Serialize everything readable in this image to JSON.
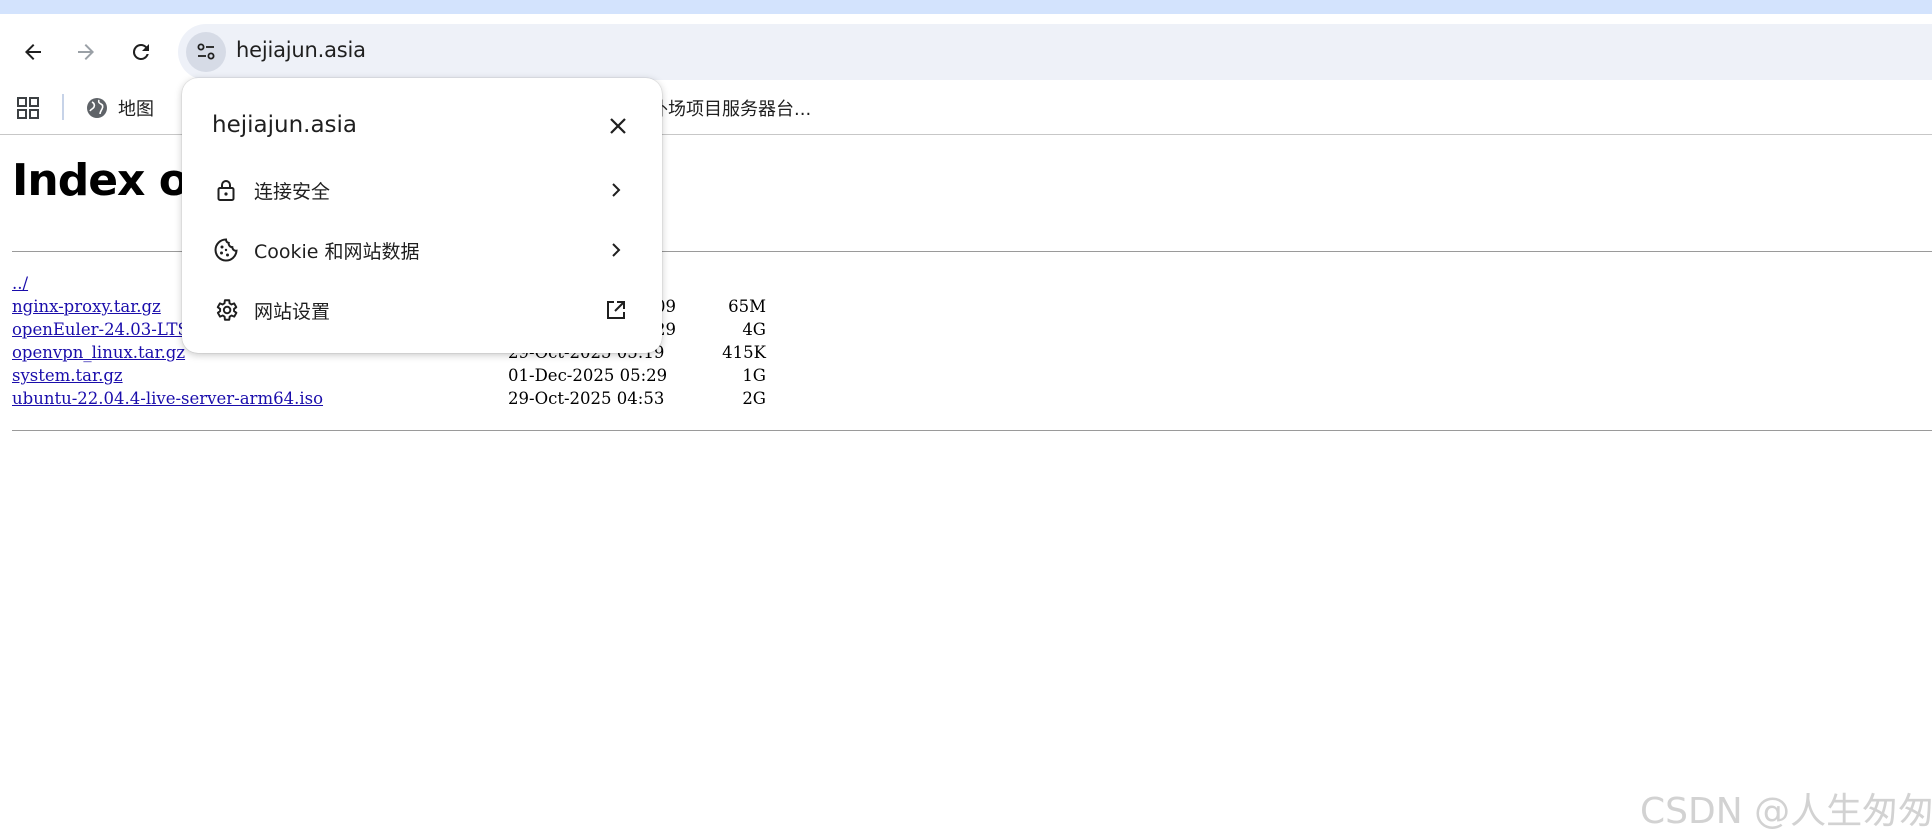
{
  "browser": {
    "url": "hejiajun.asia",
    "bookmarks": [
      {
        "label": "地图",
        "icon": "globe-icon"
      },
      {
        "label": "外场项目服务器台...",
        "icon": ""
      }
    ]
  },
  "page": {
    "heading": "Index of /",
    "parent_link": "../",
    "files": [
      {
        "name": "nginx-proxy.tar.gz",
        "date": "",
        "size": "65M"
      },
      {
        "name": "openEuler-24.03-LTS",
        "date": "",
        "size": "4G"
      },
      {
        "name": "openvpn_linux.tar.gz",
        "date": "29-Oct-2025 05:19",
        "size": "415K"
      },
      {
        "name": "system.tar.gz",
        "date": "01-Dec-2025 05:29",
        "size": "1G"
      },
      {
        "name": "ubuntu-22.04.4-live-server-arm64.iso",
        "date": "29-Oct-2025 04:53",
        "size": "2G"
      }
    ],
    "partial_dates": [
      "09",
      "29"
    ]
  },
  "site_info_popup": {
    "title": "hejiajun.asia",
    "items": [
      {
        "label": "连接安全",
        "icon": "lock-icon",
        "trail": "chevron-right-icon"
      },
      {
        "label": "Cookie 和网站数据",
        "icon": "cookie-icon",
        "trail": "chevron-right-icon"
      },
      {
        "label": "网站设置",
        "icon": "gear-icon",
        "trail": "external-link-icon"
      }
    ]
  },
  "watermark": "CSDN @人生匆匆",
  "colors": {
    "accent_strip": "#d3e3fd",
    "omnibox_bg": "#eef1f8",
    "link": "#1a0dab"
  }
}
